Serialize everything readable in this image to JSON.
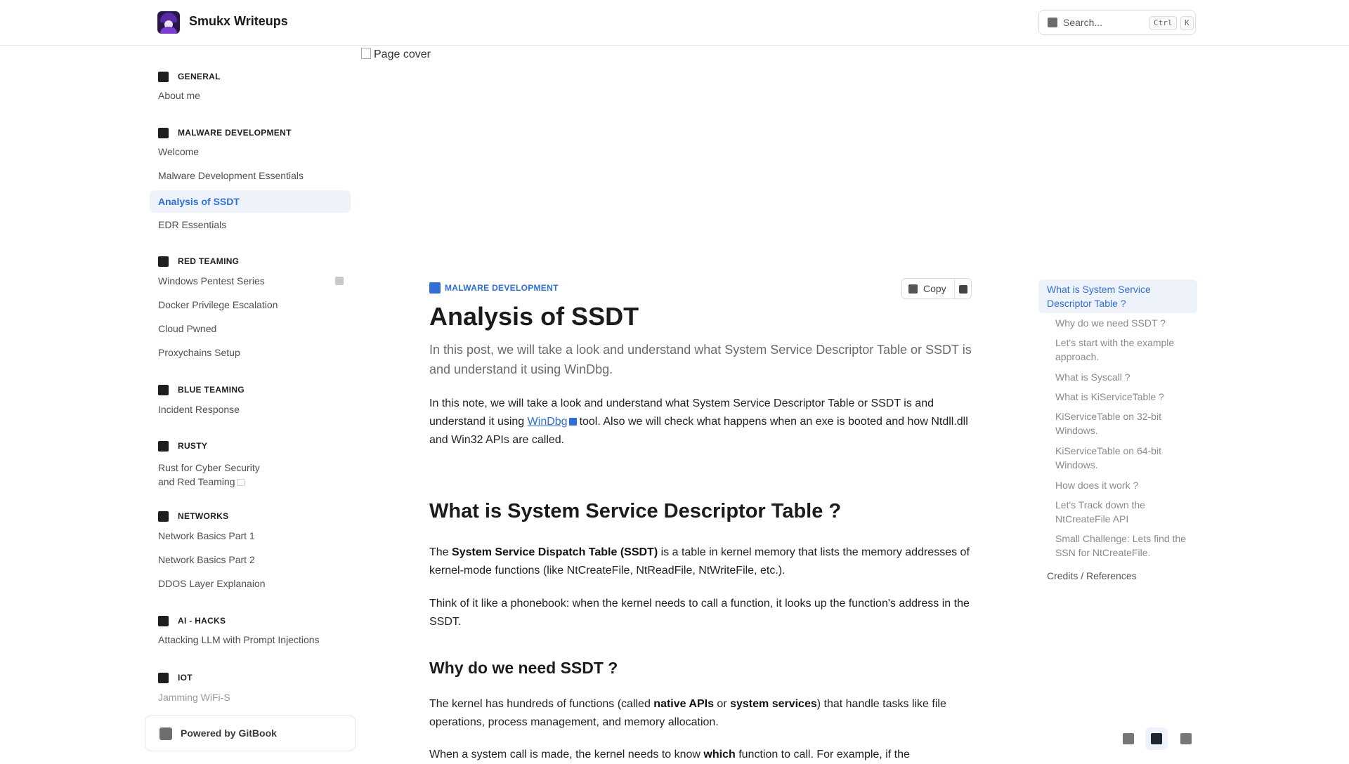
{
  "header": {
    "site_title": "Smukx Writeups",
    "search_placeholder": "Search...",
    "shortcut_ctrl": "Ctrl",
    "shortcut_key": "K"
  },
  "sidebar": {
    "sections": [
      {
        "title": "GENERAL",
        "items": [
          "About me"
        ]
      },
      {
        "title": "MALWARE DEVELOPMENT",
        "items": [
          "Welcome",
          "Malware Development Essentials",
          "Analysis of SSDT",
          "EDR Essentials"
        ]
      },
      {
        "title": "RED TEAMING",
        "items": [
          "Windows Pentest Series",
          "Docker Privilege Escalation",
          "Cloud Pwned",
          "Proxychains Setup"
        ]
      },
      {
        "title": "BLUE TEAMING",
        "items": [
          "Incident Response"
        ]
      },
      {
        "title": "RUSTY",
        "items_multiline": [
          "Rust for Cyber Security",
          "and Red Teaming"
        ]
      },
      {
        "title": "NETWORKS",
        "items": [
          "Network Basics Part 1",
          "Network Basics Part 2",
          "DDOS Layer Explanaion"
        ]
      },
      {
        "title": "AI - HACKS",
        "items": [
          "Attacking LLM with Prompt Injections"
        ]
      },
      {
        "title": "IOT",
        "items": [
          "Jamming WiFi-S"
        ]
      }
    ],
    "active_item": "Analysis of SSDT",
    "powered_by": "Powered by GitBook"
  },
  "cover": {
    "alt": "Page cover"
  },
  "content": {
    "breadcrumb": "MALWARE DEVELOPMENT",
    "copy_label": "Copy",
    "title": "Analysis of SSDT",
    "lead": "In this post, we will take a look and understand what System Service Descriptor Table or SSDT is and understand it using WinDbg.",
    "intro": {
      "before_link": "In this note, we will take a look and understand what System Service Descriptor Table or SSDT is and understand it using ",
      "link": "WinDbg",
      "after_link": "tool. Also we will check what happens when an exe is booted and how Ntdll.dll and Win32 APIs are called."
    },
    "h2_1": "What is System Service Descriptor Table ?",
    "p1": {
      "pre": "The ",
      "bold": "System Service Dispatch Table (SSDT)",
      "post": " is a table in kernel memory that lists the memory addresses of kernel-mode functions (like NtCreateFile, NtReadFile, NtWriteFile, etc.)."
    },
    "p2": "Think of it like a phonebook: when the kernel needs to call a function, it looks up the function's address in the SSDT.",
    "h3_1": "Why do we need SSDT ?",
    "p3": {
      "pre": "The kernel has hundreds of functions (called ",
      "bold1": "native APIs",
      "mid": " or ",
      "bold2": "system services",
      "post": ") that handle tasks like file operations, process management, and memory allocation."
    },
    "p4": {
      "pre": "When a system call is made, the kernel needs to know ",
      "bold": "which",
      "post": " function to call. For example, if the"
    }
  },
  "toc": {
    "items": [
      {
        "label": "What is System Service Descriptor Table ?",
        "level": 1,
        "active": true
      },
      {
        "label": "Why do we need SSDT ?",
        "level": 2
      },
      {
        "label": "Let's start with the example approach.",
        "level": 2
      },
      {
        "label": "What is Syscall ?",
        "level": 2
      },
      {
        "label": "What is KiServiceTable ?",
        "level": 2
      },
      {
        "label": "KiServiceTable on 32-bit Windows.",
        "level": 2
      },
      {
        "label": "KiServiceTable on 64-bit Windows.",
        "level": 2
      },
      {
        "label": "How does it work ?",
        "level": 2
      },
      {
        "label": "Let's Track down the NtCreateFile API",
        "level": 2
      },
      {
        "label": "Small Challenge: Lets find the SSN for NtCreateFile.",
        "level": 2
      },
      {
        "label": "Credits / References",
        "level": 1
      }
    ]
  },
  "theme": {
    "icons": [
      "sun-icon",
      "monitor-icon",
      "moon-icon"
    ]
  }
}
